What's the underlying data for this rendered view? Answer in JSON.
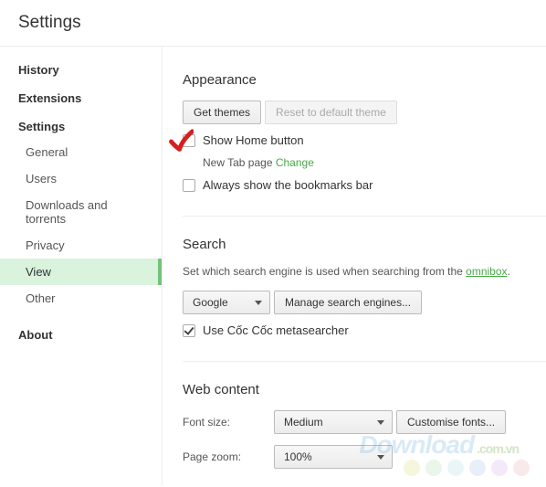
{
  "header": {
    "title": "Settings"
  },
  "sidebar": {
    "history": "History",
    "extensions": "Extensions",
    "settings": "Settings",
    "subs": {
      "general": "General",
      "users": "Users",
      "downloads": "Downloads and torrents",
      "privacy": "Privacy",
      "view": "View",
      "other": "Other"
    },
    "about": "About"
  },
  "appearance": {
    "title": "Appearance",
    "get_themes": "Get themes",
    "reset_theme": "Reset to default theme",
    "show_home": "Show Home button",
    "new_tab_page": "New Tab page",
    "change": "Change",
    "always_bookmarks": "Always show the bookmarks bar"
  },
  "search": {
    "title": "Search",
    "desc_pre": "Set which search engine is used when searching from the ",
    "omnibox": "omnibox",
    "desc_post": ".",
    "engine": "Google",
    "manage": "Manage search engines...",
    "metasearcher": "Use Cốc Cốc metasearcher"
  },
  "webcontent": {
    "title": "Web content",
    "font_size_label": "Font size:",
    "font_size_value": "Medium",
    "customise_fonts": "Customise fonts...",
    "page_zoom_label": "Page zoom:",
    "page_zoom_value": "100%"
  },
  "watermark": {
    "main": "Download",
    "suffix": ".com.vn"
  },
  "dot_colors": [
    "#e8e8a8",
    "#c9e9c9",
    "#c9e9e6",
    "#c9d8ef",
    "#e4c9ef",
    "#efc9c9"
  ]
}
